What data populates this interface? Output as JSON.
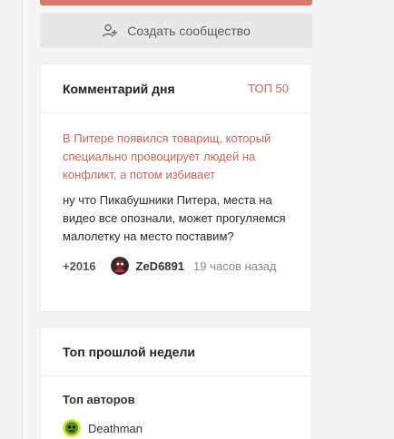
{
  "create_community": {
    "label": "Создать сообщество",
    "icon": "add-user-icon"
  },
  "comment_of_day": {
    "title": "Комментарий дня",
    "top_link": "ТОП 50",
    "post_title": "В Питере появился товарищ, который специально провоцирует людей на конфликт, а потом избивает",
    "comment_text": "ну что Пикабушники Питера, места на видео все опознали, может прогуляемся малолетку на место поставим?",
    "rating": "+2016",
    "username": "ZeD6891",
    "time": "19 часов назад"
  },
  "top_last_week": {
    "title": "Топ прошлой недели",
    "section_label": "Топ авторов",
    "authors": [
      {
        "name": "Deathman"
      }
    ]
  },
  "colors": {
    "accent": "#c7655a",
    "button_bg": "#e8e8e9",
    "top_bar": "#d9776b"
  }
}
